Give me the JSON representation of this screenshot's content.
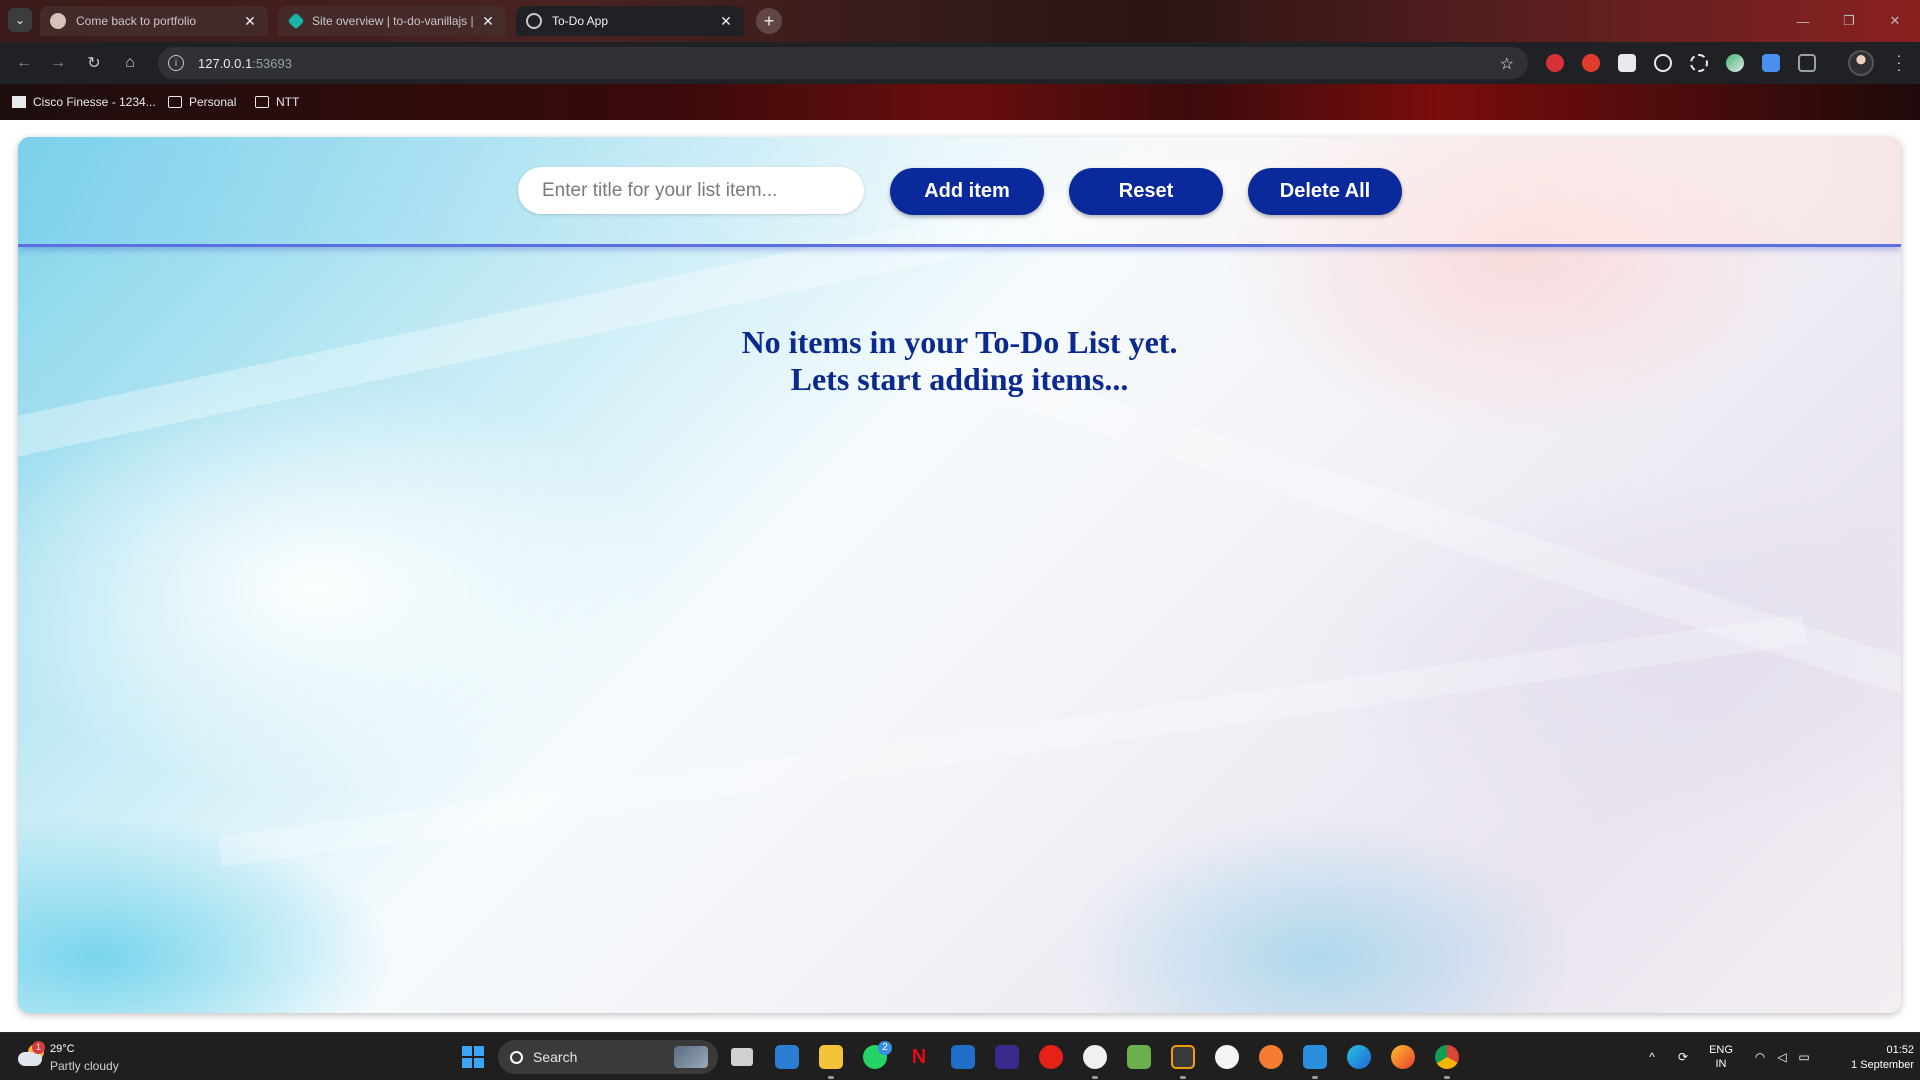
{
  "browser": {
    "tabs": [
      {
        "title": "Come back to portfolio",
        "active": false
      },
      {
        "title": "Site overview | to-do-vanillajs |",
        "active": false
      },
      {
        "title": "To-Do App",
        "active": true
      }
    ],
    "url_host": "127.0.0.1",
    "url_port": ":53693",
    "bookmarks": [
      {
        "label": "Cisco Finesse - 1234..."
      },
      {
        "label": "Personal"
      },
      {
        "label": "NTT"
      }
    ],
    "extension_icons": [
      "adblock-plus-icon",
      "red-extension-icon",
      "s-extension-icon",
      "target-extension-icon",
      "gear-extension-icon",
      "green-extension-icon",
      "blue-extension-icon",
      "puzzle-extensions-icon"
    ]
  },
  "app": {
    "input_placeholder": "Enter title for your list item...",
    "add_label": "Add item",
    "reset_label": "Reset",
    "delete_all_label": "Delete All",
    "empty_line1": "No items in your To-Do List yet.",
    "empty_line2": "Lets start adding items..."
  },
  "colors": {
    "button_bg": "#0a2a9c",
    "message_text": "#0b2a8f",
    "header_border": "#5b6fe0"
  },
  "taskbar": {
    "weather_temp": "29°C",
    "weather_desc": "Partly cloudy",
    "weather_badge": "1",
    "search_label": "Search",
    "whatsapp_badge": "2",
    "lang_line1": "ENG",
    "lang_line2": "IN",
    "time": "01:52",
    "date": "1 September"
  }
}
